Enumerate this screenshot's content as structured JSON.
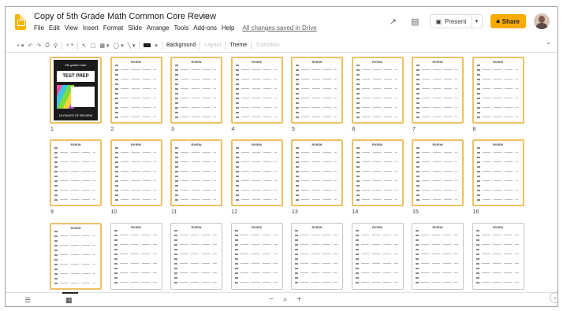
{
  "app": {
    "title": "Copy of 5th Grade Math Common Core Review",
    "star_icon": "star-outline-icon",
    "folder_icon": "move-to-folder-icon"
  },
  "menu": [
    "File",
    "Edit",
    "View",
    "Insert",
    "Format",
    "Slide",
    "Arrange",
    "Tools",
    "Add-ons",
    "Help"
  ],
  "saved_status": "All changes saved in Drive",
  "header_actions": {
    "present_label": "Present",
    "share_label": "Share",
    "accent": "#f9ab00"
  },
  "toolbar": {
    "background_label": "Background",
    "layout_label": "Layout",
    "theme_label": "Theme",
    "transition_label": "Transition"
  },
  "slides": [
    {
      "num": "1",
      "title": "",
      "type": "cover",
      "highlighted": true
    },
    {
      "num": "2",
      "title": "RVIEW",
      "type": "worksheet",
      "highlighted": true
    },
    {
      "num": "3",
      "title": "RVIEW",
      "type": "worksheet",
      "highlighted": true
    },
    {
      "num": "4",
      "title": "RVIEW",
      "type": "worksheet",
      "highlighted": true
    },
    {
      "num": "5",
      "title": "RVIEW",
      "type": "worksheet",
      "highlighted": true
    },
    {
      "num": "6",
      "title": "RVIEW",
      "type": "worksheet",
      "highlighted": true
    },
    {
      "num": "7",
      "title": "RVIEW",
      "type": "worksheet",
      "highlighted": true
    },
    {
      "num": "8",
      "title": "RVIEW",
      "type": "worksheet",
      "highlighted": true
    },
    {
      "num": "9",
      "title": "RVIEW",
      "type": "worksheet",
      "highlighted": true
    },
    {
      "num": "10",
      "title": "RVIEW",
      "type": "worksheet",
      "highlighted": true
    },
    {
      "num": "11",
      "title": "RVIEW",
      "type": "worksheet",
      "highlighted": true
    },
    {
      "num": "12",
      "title": "RVIEW",
      "type": "worksheet",
      "highlighted": true
    },
    {
      "num": "13",
      "title": "RVIEW",
      "type": "worksheet",
      "highlighted": true
    },
    {
      "num": "14",
      "title": "RVIEW",
      "type": "worksheet",
      "highlighted": true
    },
    {
      "num": "15",
      "title": "RVIEW",
      "type": "worksheet",
      "highlighted": true
    },
    {
      "num": "16",
      "title": "RVIEW",
      "type": "worksheet",
      "highlighted": true
    },
    {
      "num": "",
      "title": "RVIEW",
      "type": "worksheet",
      "highlighted": true
    },
    {
      "num": "",
      "title": "RVIEW",
      "type": "worksheet",
      "highlighted": false
    },
    {
      "num": "",
      "title": "RVIEW",
      "type": "worksheet",
      "highlighted": false
    },
    {
      "num": "",
      "title": "RVIEW",
      "type": "worksheet",
      "highlighted": false
    },
    {
      "num": "",
      "title": "RVIEW",
      "type": "worksheet",
      "highlighted": false
    },
    {
      "num": "",
      "title": "RVIEW",
      "type": "worksheet",
      "highlighted": false
    },
    {
      "num": "",
      "title": "RVIEW",
      "type": "worksheet",
      "highlighted": false
    },
    {
      "num": "",
      "title": "RVIEW",
      "type": "worksheet",
      "highlighted": false
    }
  ],
  "cover": {
    "top_text": "5th grade math",
    "band_text": "TEST PREP REVIEW",
    "footer_text": "16 PAGES OF REVIEW"
  }
}
